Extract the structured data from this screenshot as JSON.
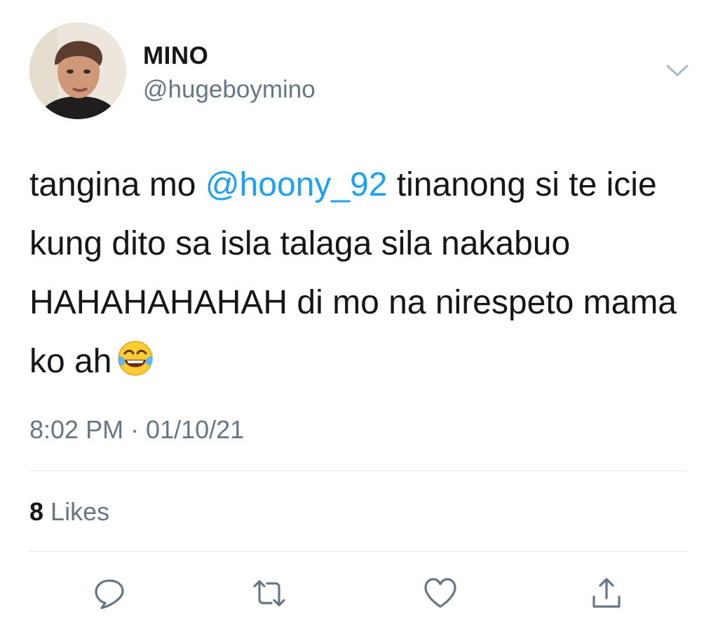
{
  "user": {
    "display_name": "MINO",
    "handle": "@hugeboymino"
  },
  "tweet": {
    "text_before": "tangina mo ",
    "mention": "@hoony_92",
    "text_after": " tinanong si te icie kung dito sa isla talaga sila nakabuo HAHAHAHAHAH di mo na nirespeto mama ko ah",
    "emoji": "face-with-tears-of-joy",
    "timestamp": "8:02 PM · 01/10/21"
  },
  "stats": {
    "likes_count": "8",
    "likes_label": "Likes"
  },
  "actions": [
    "reply-icon",
    "retweet-icon",
    "like-icon",
    "share-icon"
  ],
  "colors": {
    "link": "#1da1f2",
    "secondary_text": "#657786",
    "primary_text": "#14171a",
    "divider": "#e1e8ed"
  }
}
